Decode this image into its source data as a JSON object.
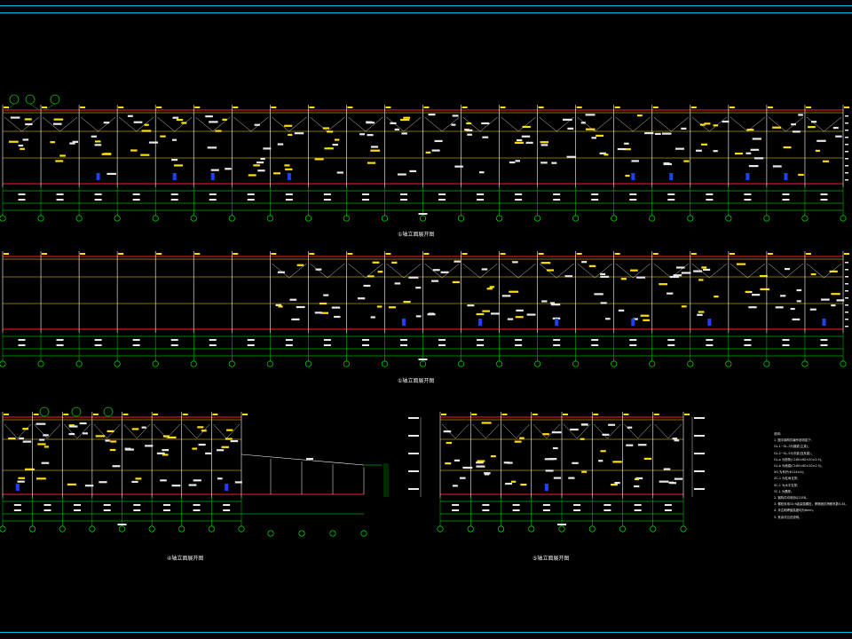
{
  "sheet": {
    "colors": {
      "background": "#000000",
      "frame": "#00bfe8",
      "column_line": "#ffffff",
      "grid_line": "#00ff00",
      "beam_red": "#ff2020",
      "beam_yellow": "#ffe000",
      "text_white": "#e8e8e8",
      "tag_yellow": "#ffe000",
      "axis_bubble": "#00ff00",
      "magenta": "#ff40ff",
      "blue": "#2040ff"
    }
  },
  "elevations": [
    {
      "id": "elev-1",
      "caption": "①轴立面展开图"
    },
    {
      "id": "elev-2",
      "caption": "①轴立面展开图"
    },
    {
      "id": "elev-3",
      "caption": "④轴立面展开图"
    },
    {
      "id": "elev-4",
      "caption": "⑤轴立面展开图"
    }
  ],
  "notes": {
    "heading": "说明：",
    "lines": [
      "1. 图中钢构件编号说明如下：",
      "   GL-1~GL-3为钢梁(主梁)；",
      "   GL-2~GL-5为次梁(连系梁)；",
      "   GL-a 为檩条(C160×60×20×2.5)；",
      "   GL-b 为墙梁(C160×60×20×2.5)；",
      "   XG 为系杆(Φ114×4)；",
      "   ZC-1 为柱间支撑；",
      "   SC-1 为水平支撑；",
      "   YC-1 为隅撑；",
      "2. 钢构件均采用Q235B。",
      "3. 螺栓采用10.9级高强螺栓，摩擦面抗滑移系数0.45。",
      "4. 未注明焊缝高度均为6mm。",
      "5. 其余详见总说明。"
    ]
  }
}
